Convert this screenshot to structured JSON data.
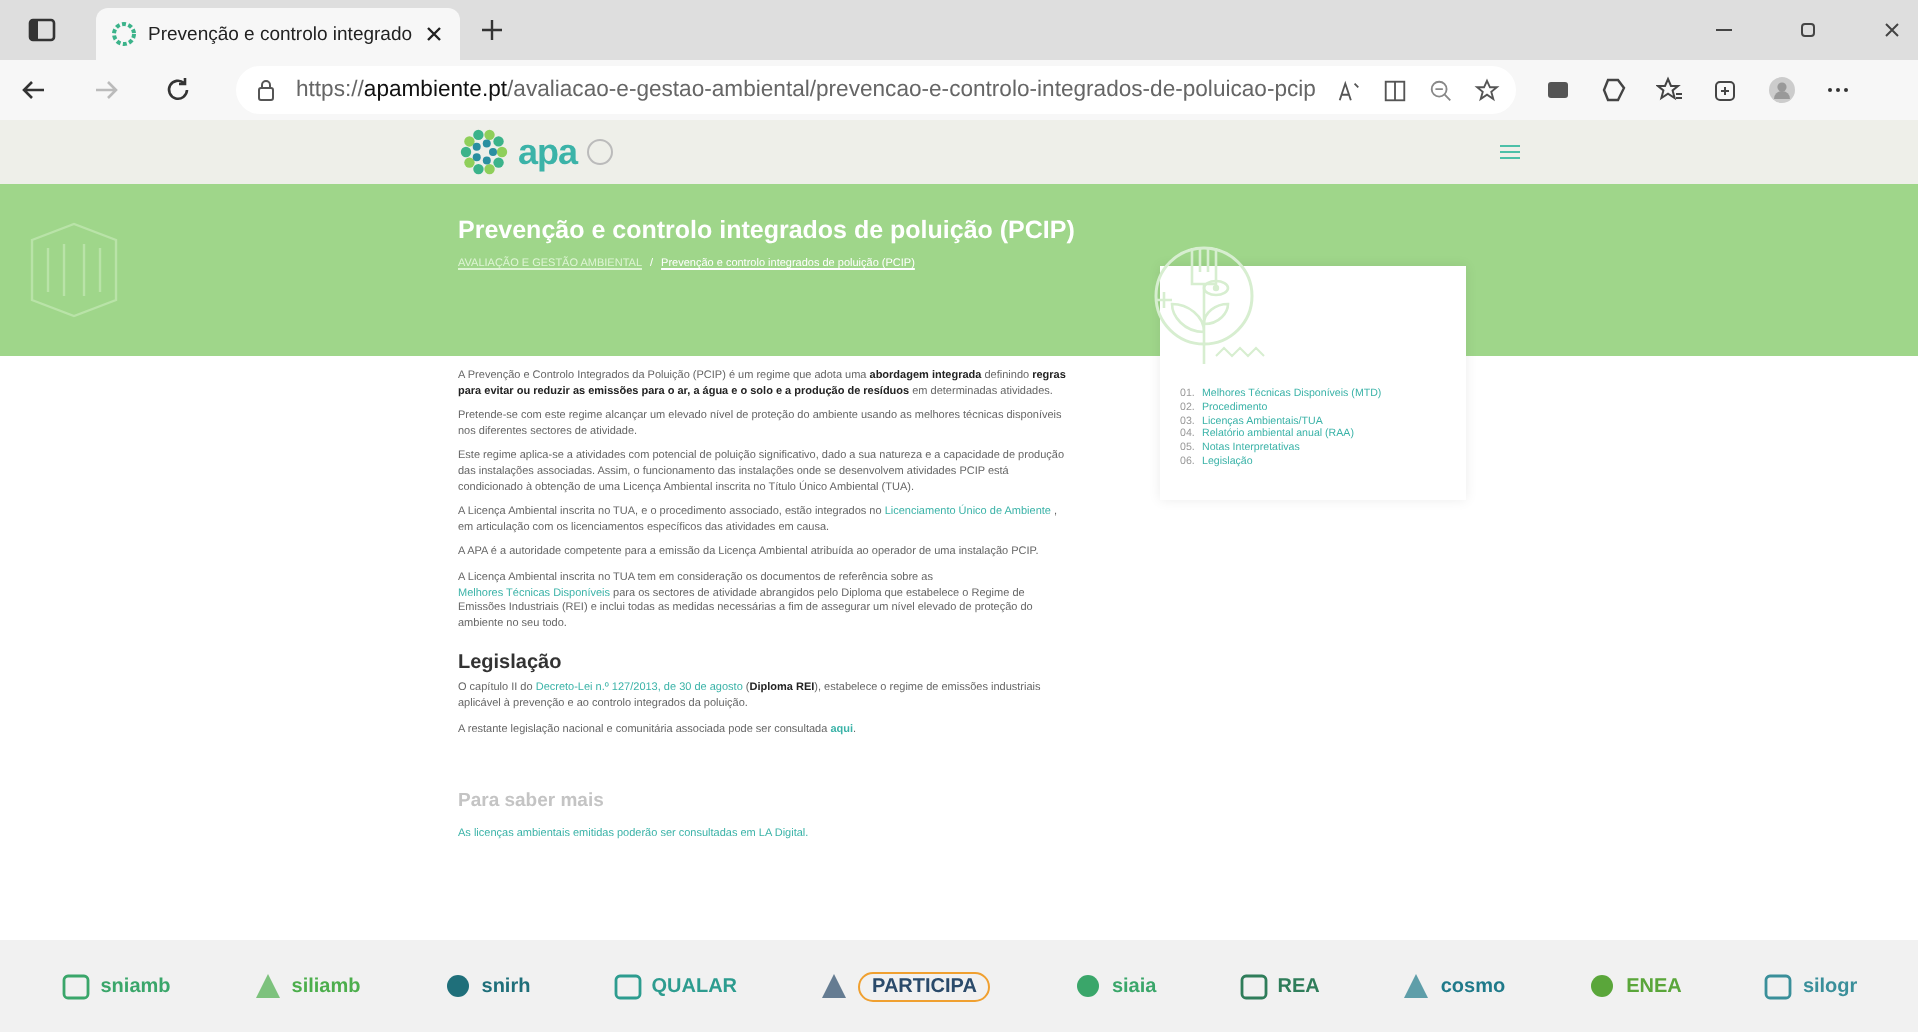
{
  "browser": {
    "tab_title": "Prevenção e controlo integrado",
    "url": "https://**apambiente.pt**/avaliacao-e-gestao-ambiental/prevencao-e-controlo-integrados-de-poluicao-pcip"
  },
  "site": {
    "logo": "apa"
  },
  "banner": {
    "title": "Prevenção e controlo integrados de poluição (PCIP)",
    "breadcrumbs": [
      {
        "label": "AVALIAÇÃO E GESTÃO AMBIENTAL",
        "selected": false
      },
      {
        "label": "Prevenção e controlo integrados de poluição (PCIP)",
        "selected": true
      }
    ],
    "separator": "/"
  },
  "paragraphs": [
    [
      {
        "kind": "text",
        "text": "A Prevenção e Controlo Integrados da Poluição (PCIP) é um regime que adota uma **abordagem integrada** definindo **regras para evitar ou reduzir as emissões para o ar, a água e o solo e a produção de resíduos** em determinadas atividades."
      }
    ],
    [
      {
        "kind": "text",
        "text": "Pretende-se com este regime alcançar um elevado nível de proteção do ambiente usando as melhores técnicas disponíveis nos diferentes sectores de atividade."
      }
    ],
    [
      {
        "kind": "text",
        "text": "Este regime aplica-se a atividades com potencial de poluição significativo, dado a sua natureza e a capacidade de produção das instalações associadas. Assim, o funcionamento das instalações onde se desenvolvem atividades PCIP está condicionado à obtenção de uma Licença Ambiental inscrita no Título Único Ambiental (TUA)."
      }
    ],
    [
      {
        "kind": "text",
        "text": "A Licença Ambiental inscrita no TUA, e o procedimento associado, estão integrados no"
      },
      {
        "kind": "link",
        "text": "Licenciamento Único de Ambiente"
      },
      {
        "kind": "text",
        "text": ", em articulação com os licenciamentos específicos das atividades em causa."
      }
    ],
    [
      {
        "kind": "text",
        "text": "A APA é a autoridade competente para a emissão da Licença Ambiental atribuída ao operador de uma instalação PCIP."
      }
    ],
    [
      {
        "kind": "text",
        "text": "A Licença Ambiental inscrita no TUA tem em consideração os documentos de referência sobre as"
      },
      {
        "kind": "link",
        "text": "Melhores Técnicas Disponíveis"
      },
      {
        "kind": "text",
        "text": "para os sectores de atividade abrangidos pelo Diploma que estabelece o Regime de Emissões Industriais (REI) e inclui todas as medidas necessárias a fim de assegurar um nível elevado de proteção do ambiente no seu todo."
      }
    ]
  ],
  "legislation": {
    "heading": "Legislação",
    "paragraphs": [
      [
        {
          "kind": "text",
          "text": "O capítulo II do"
        },
        {
          "kind": "link",
          "text": "Decreto-Lei n.º 127/2013, de 30 de agosto"
        },
        {
          "kind": "text",
          "text": "(**Diploma REI**), estabelece o regime de emissões industriais aplicável à prevenção e ao controlo integrados da poluição."
        }
      ],
      [
        {
          "kind": "text",
          "text": "A restante legislação nacional e comunitária associada pode ser consultada"
        },
        {
          "kind": "boldlink",
          "text": "aqui"
        },
        {
          "kind": "text",
          "text": "."
        }
      ]
    ]
  },
  "more": {
    "heading": "Para saber mais",
    "link": "As licenças ambientais emitidas poderão ser consultadas em LA Digital."
  },
  "toc": [
    {
      "number": "01.",
      "label": "Melhores Técnicas Disponíveis (MTD)"
    },
    {
      "number": "02.",
      "label": "Procedimento"
    },
    {
      "number": "03.",
      "label": "Licenças Ambientais/TUA"
    },
    {
      "number": "04.",
      "label": "Relatório ambiental anual (RAA)"
    },
    {
      "number": "05.",
      "label": "Notas Interpretativas"
    },
    {
      "number": "06.",
      "label": "Legislação"
    }
  ],
  "partners": [
    {
      "name": "sniamb",
      "color": "#3aa66a"
    },
    {
      "name": "siliamb",
      "color": "#4cae4c"
    },
    {
      "name": "snirh",
      "color": "#1f6f7a"
    },
    {
      "name": "QUALAR",
      "color": "#2d9c8f"
    },
    {
      "name": "PARTICIPA",
      "color": "#2a4a6a"
    },
    {
      "name": "siaia",
      "color": "#3aa66a"
    },
    {
      "name": "REA",
      "color": "#2f7d5a"
    },
    {
      "name": "cosmo",
      "color": "#1f7a8a"
    },
    {
      "name": "ENEA",
      "color": "#5aa63a"
    },
    {
      "name": "silogr",
      "color": "#3a8f9a"
    }
  ]
}
